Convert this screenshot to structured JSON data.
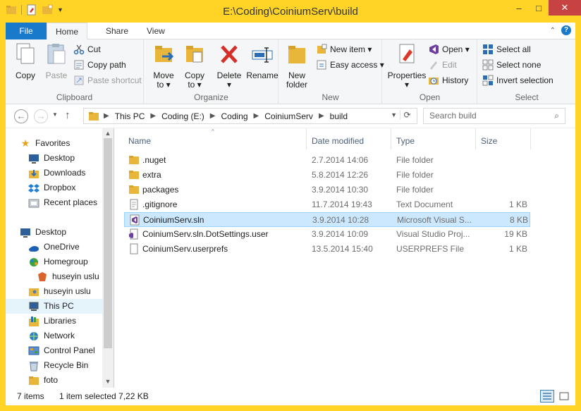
{
  "window": {
    "title": "E:\\Coding\\CoiniumServ\\build"
  },
  "controls": {
    "minimize": "–",
    "maximize": "□",
    "close": "✕"
  },
  "ribbon_tabs": {
    "file": "File",
    "home": "Home",
    "share": "Share",
    "view": "View"
  },
  "ribbon": {
    "clipboard": {
      "label": "Clipboard",
      "copy": "Copy",
      "paste": "Paste",
      "cut": "Cut",
      "copy_path": "Copy path",
      "paste_shortcut": "Paste shortcut"
    },
    "organize": {
      "label": "Organize",
      "move_to": "Move",
      "move_to2": "to ▾",
      "copy_to": "Copy",
      "copy_to2": "to ▾",
      "delete": "Delete",
      "delete2": "▾",
      "rename": "Rename"
    },
    "new": {
      "label": "New",
      "new_folder": "New",
      "new_folder2": "folder",
      "new_item": "New item ▾",
      "easy_access": "Easy access ▾"
    },
    "open": {
      "label": "Open",
      "properties": "Properties",
      "properties2": "▾",
      "open": "Open ▾",
      "edit": "Edit",
      "history": "History"
    },
    "select": {
      "label": "Select",
      "select_all": "Select all",
      "select_none": "Select none",
      "invert_selection": "Invert selection"
    }
  },
  "address": {
    "crumbs": [
      "This PC",
      "Coding (E:)",
      "Coding",
      "CoiniumServ",
      "build"
    ],
    "search_placeholder": "Search build"
  },
  "nav": {
    "favorites": "Favorites",
    "desktop_fav": "Desktop",
    "downloads": "Downloads",
    "dropbox": "Dropbox",
    "recent": "Recent places",
    "desktop": "Desktop",
    "onedrive": "OneDrive",
    "homegroup": "Homegroup",
    "user1": "huseyin uslu",
    "user2": "huseyin uslu",
    "thispc": "This PC",
    "libraries": "Libraries",
    "network": "Network",
    "controlpanel": "Control Panel",
    "recyclebin": "Recycle Bin",
    "foto": "foto"
  },
  "columns": {
    "name": "Name",
    "date": "Date modified",
    "type": "Type",
    "size": "Size"
  },
  "files": [
    {
      "name": ".nuget",
      "date": "2.7.2014 14:06",
      "type": "File folder",
      "size": "",
      "icon": "folder"
    },
    {
      "name": "extra",
      "date": "5.8.2014 12:26",
      "type": "File folder",
      "size": "",
      "icon": "folder"
    },
    {
      "name": "packages",
      "date": "3.9.2014 10:30",
      "type": "File folder",
      "size": "",
      "icon": "folder"
    },
    {
      "name": ".gitignore",
      "date": "11.7.2014 19:43",
      "type": "Text Document",
      "size": "1 KB",
      "icon": "text"
    },
    {
      "name": "CoiniumServ.sln",
      "date": "3.9.2014 10:28",
      "type": "Microsoft Visual S...",
      "size": "8 KB",
      "icon": "vs"
    },
    {
      "name": "CoiniumServ.sln.DotSettings.user",
      "date": "3.9.2014 10:09",
      "type": "Visual Studio Proj...",
      "size": "19 KB",
      "icon": "vsproj"
    },
    {
      "name": "CoiniumServ.userprefs",
      "date": "13.5.2014 15:40",
      "type": "USERPREFS File",
      "size": "1 KB",
      "icon": "blank"
    }
  ],
  "status": {
    "count": "7 items",
    "selection": "1 item selected  7,22 KB"
  },
  "colors": {
    "accent": "#1979ca",
    "frame": "#ffd426",
    "selection": "#cce8ff"
  }
}
